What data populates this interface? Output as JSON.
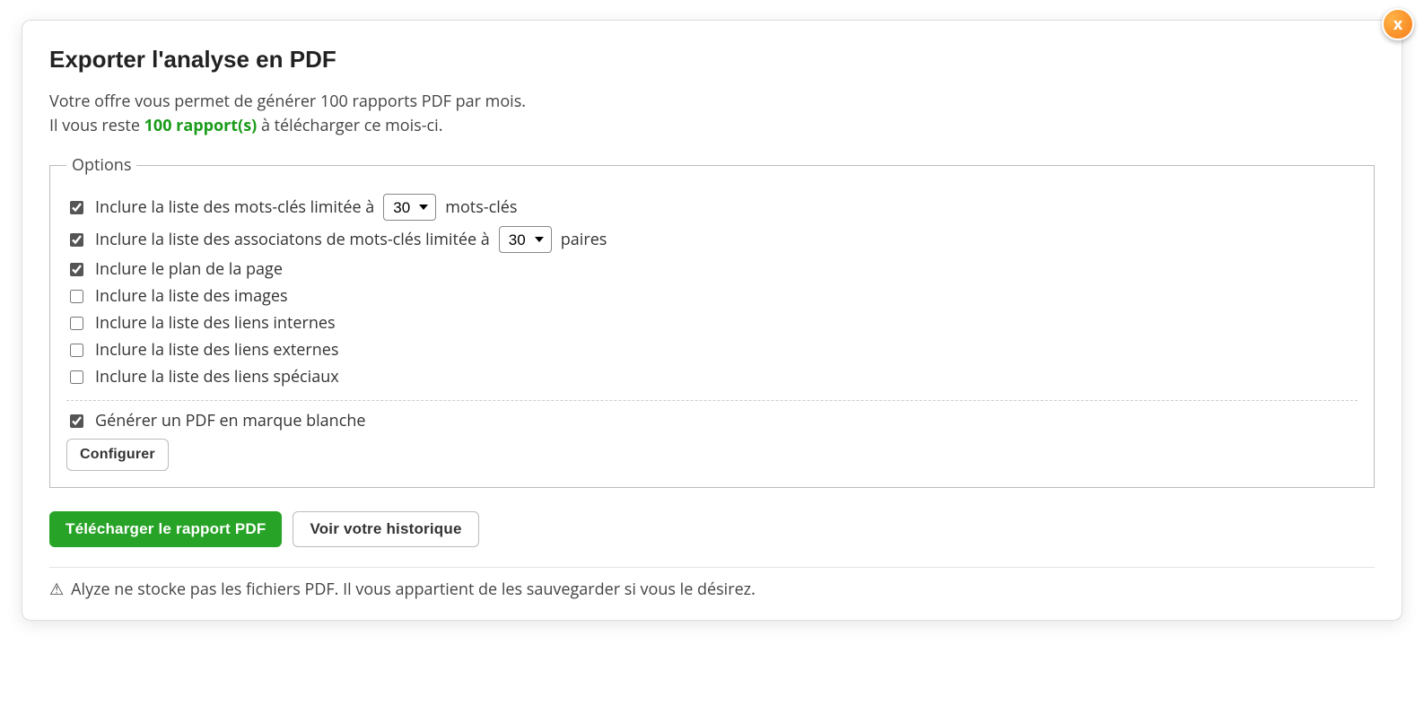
{
  "dialog": {
    "title": "Exporter l'analyse en PDF",
    "close_label": "x",
    "intro_line1": "Votre offre vous permet de générer 100 rapports PDF par mois.",
    "intro_line2_prefix": "Il vous reste ",
    "intro_line2_remaining": "100 rapport(s)",
    "intro_line2_suffix": " à télécharger ce mois-ci."
  },
  "options": {
    "legend": "Options",
    "keywords": {
      "checked": true,
      "label_prefix": "Inclure la liste des mots-clés limitée à",
      "value": "30",
      "label_suffix": "mots-clés"
    },
    "associations": {
      "checked": true,
      "label_prefix": "Inclure la liste des associatons de mots-clés limitée à",
      "value": "30",
      "label_suffix": "paires"
    },
    "plan": {
      "checked": true,
      "label": "Inclure le plan de la page"
    },
    "images": {
      "checked": false,
      "label": "Inclure la liste des images"
    },
    "internal": {
      "checked": false,
      "label": "Inclure la liste des liens internes"
    },
    "external": {
      "checked": false,
      "label": "Inclure la liste des liens externes"
    },
    "special": {
      "checked": false,
      "label": "Inclure la liste des liens spéciaux"
    },
    "whitelabel": {
      "checked": true,
      "label": "Générer un PDF en marque blanche"
    },
    "configure_button": "Configurer"
  },
  "actions": {
    "download": "Télécharger le rapport PDF",
    "history": "Voir votre historique"
  },
  "footer": {
    "note": "Alyze ne stocke pas les fichiers PDF. Il vous appartient de les sauvegarder si vous le désirez."
  }
}
